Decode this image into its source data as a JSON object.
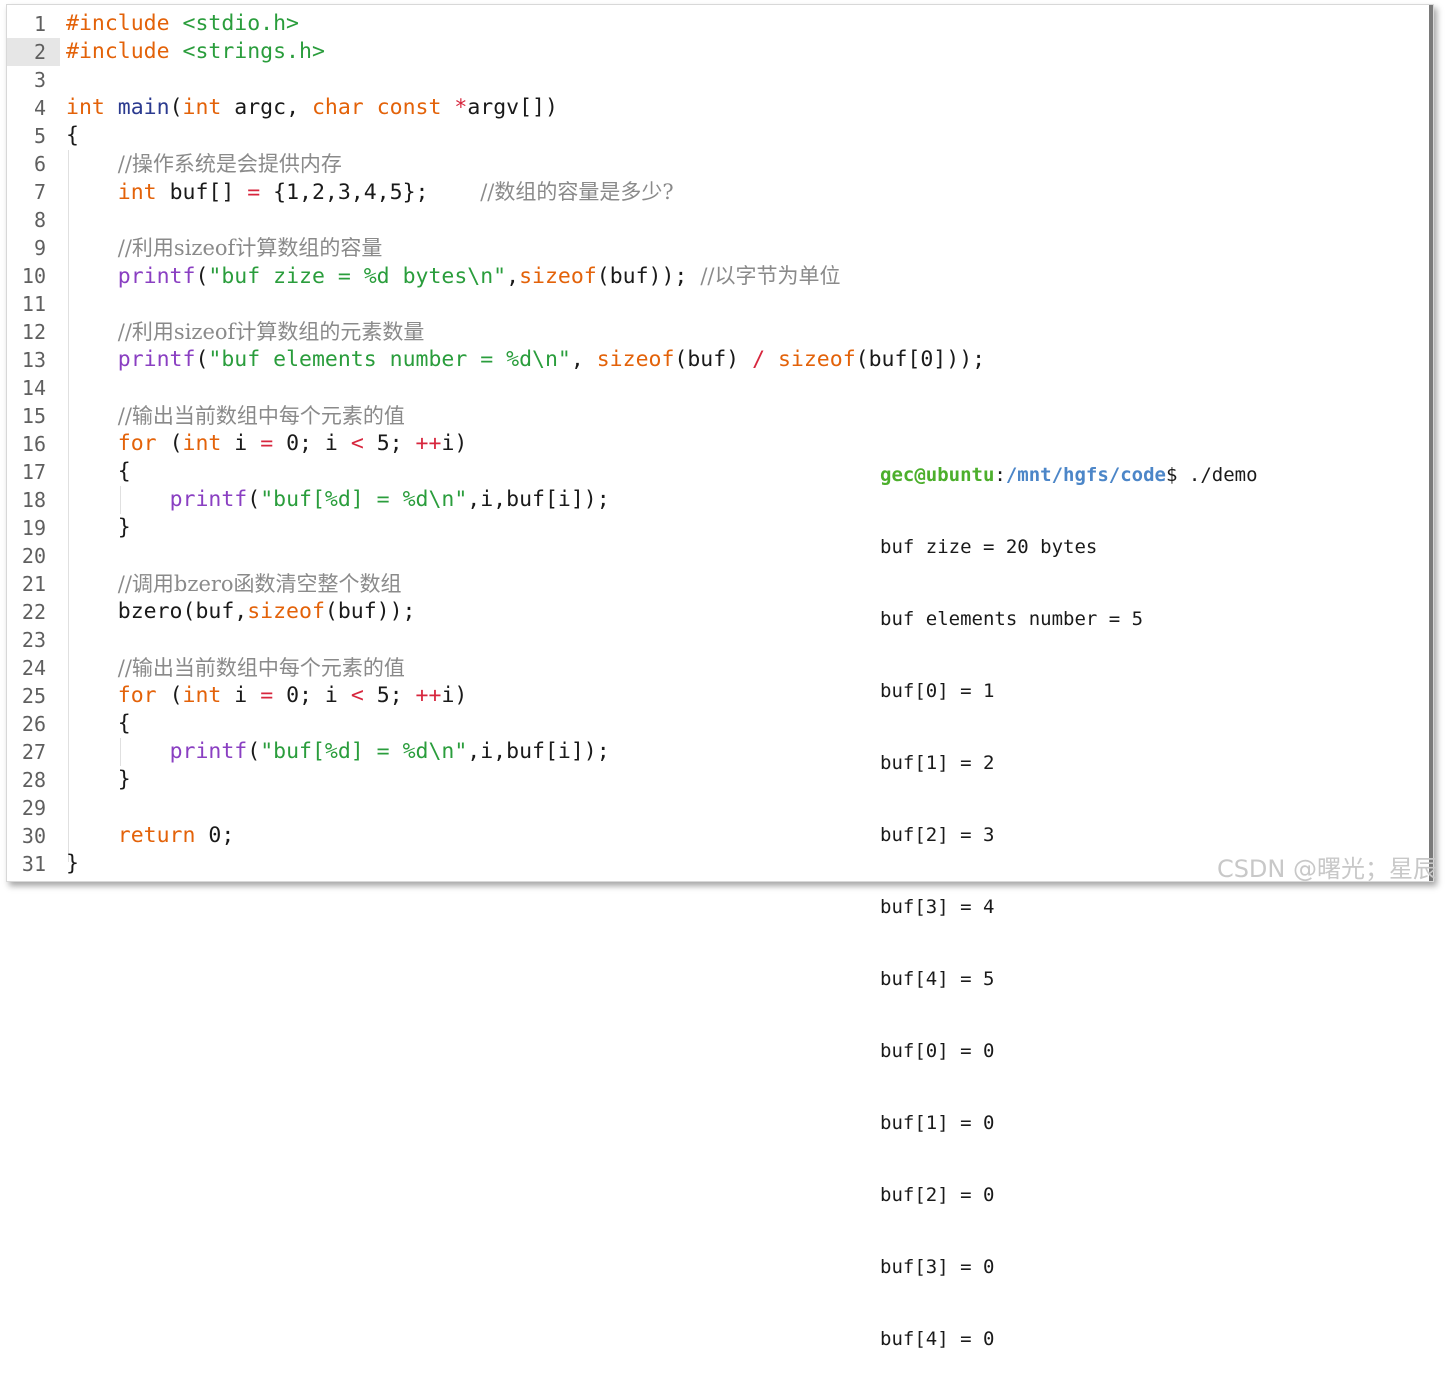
{
  "editor": {
    "highlighted_line": 2,
    "lines": [
      {
        "n": "1",
        "tokens": [
          [
            "kw",
            "#include "
          ],
          [
            "str",
            "<stdio.h>"
          ]
        ]
      },
      {
        "n": "2",
        "tokens": [
          [
            "kw",
            "#include "
          ],
          [
            "str",
            "<strings.h>"
          ]
        ]
      },
      {
        "n": "3",
        "tokens": []
      },
      {
        "n": "4",
        "tokens": [
          [
            "kw",
            "int "
          ],
          [
            "mainfn",
            "main"
          ],
          [
            "id",
            "("
          ],
          [
            "kw",
            "int "
          ],
          [
            "id",
            "argc, "
          ],
          [
            "kw",
            "char const "
          ],
          [
            "op",
            "*"
          ],
          [
            "id",
            "argv[])"
          ]
        ]
      },
      {
        "n": "5",
        "tokens": [
          [
            "id",
            "{"
          ]
        ]
      },
      {
        "n": "6",
        "tokens": [
          [
            "id",
            "    "
          ],
          [
            "com",
            "//操作系统是会提供内存"
          ]
        ]
      },
      {
        "n": "7",
        "tokens": [
          [
            "id",
            "    "
          ],
          [
            "kw",
            "int "
          ],
          [
            "id",
            "buf[] "
          ],
          [
            "op",
            "= "
          ],
          [
            "id",
            "{1,2,3,4,5};    "
          ],
          [
            "com",
            "//数组的容量是多少?"
          ]
        ]
      },
      {
        "n": "8",
        "tokens": []
      },
      {
        "n": "9",
        "tokens": [
          [
            "id",
            "    "
          ],
          [
            "com",
            "//利用sizeof计算数组的容量"
          ]
        ]
      },
      {
        "n": "10",
        "tokens": [
          [
            "id",
            "    "
          ],
          [
            "fn",
            "printf"
          ],
          [
            "id",
            "("
          ],
          [
            "str",
            "\"buf zize = %d bytes\\n\""
          ],
          [
            "id",
            ","
          ],
          [
            "kw",
            "sizeof"
          ],
          [
            "id",
            "(buf)); "
          ],
          [
            "com",
            "//以字节为单位"
          ]
        ]
      },
      {
        "n": "11",
        "tokens": []
      },
      {
        "n": "12",
        "tokens": [
          [
            "id",
            "    "
          ],
          [
            "com",
            "//利用sizeof计算数组的元素数量"
          ]
        ]
      },
      {
        "n": "13",
        "tokens": [
          [
            "id",
            "    "
          ],
          [
            "fn",
            "printf"
          ],
          [
            "id",
            "("
          ],
          [
            "str",
            "\"buf elements number = %d\\n\""
          ],
          [
            "id",
            ", "
          ],
          [
            "kw",
            "sizeof"
          ],
          [
            "id",
            "(buf) "
          ],
          [
            "op",
            "/ "
          ],
          [
            "kw",
            "sizeof"
          ],
          [
            "id",
            "(buf[0]));"
          ]
        ]
      },
      {
        "n": "14",
        "tokens": []
      },
      {
        "n": "15",
        "tokens": [
          [
            "id",
            "    "
          ],
          [
            "com",
            "//输出当前数组中每个元素的值"
          ]
        ]
      },
      {
        "n": "16",
        "tokens": [
          [
            "id",
            "    "
          ],
          [
            "kw",
            "for "
          ],
          [
            "id",
            "("
          ],
          [
            "kw",
            "int "
          ],
          [
            "id",
            "i "
          ],
          [
            "op",
            "= "
          ],
          [
            "id",
            "0; i "
          ],
          [
            "op",
            "< "
          ],
          [
            "id",
            "5; "
          ],
          [
            "op",
            "++"
          ],
          [
            "id",
            "i)"
          ]
        ]
      },
      {
        "n": "17",
        "tokens": [
          [
            "id",
            "    {"
          ]
        ]
      },
      {
        "n": "18",
        "tokens": [
          [
            "id",
            "        "
          ],
          [
            "fn",
            "printf"
          ],
          [
            "id",
            "("
          ],
          [
            "str",
            "\"buf[%d] = %d\\n\""
          ],
          [
            "id",
            ",i,buf[i]);"
          ]
        ]
      },
      {
        "n": "19",
        "tokens": [
          [
            "id",
            "    }"
          ]
        ]
      },
      {
        "n": "20",
        "tokens": []
      },
      {
        "n": "21",
        "tokens": [
          [
            "id",
            "    "
          ],
          [
            "com",
            "//调用bzero函数清空整个数组"
          ]
        ]
      },
      {
        "n": "22",
        "tokens": [
          [
            "id",
            "    bzero(buf,"
          ],
          [
            "kw",
            "sizeof"
          ],
          [
            "id",
            "(buf));"
          ]
        ]
      },
      {
        "n": "23",
        "tokens": []
      },
      {
        "n": "24",
        "tokens": [
          [
            "id",
            "    "
          ],
          [
            "com",
            "//输出当前数组中每个元素的值"
          ]
        ]
      },
      {
        "n": "25",
        "tokens": [
          [
            "id",
            "    "
          ],
          [
            "kw",
            "for "
          ],
          [
            "id",
            "("
          ],
          [
            "kw",
            "int "
          ],
          [
            "id",
            "i "
          ],
          [
            "op",
            "= "
          ],
          [
            "id",
            "0; i "
          ],
          [
            "op",
            "< "
          ],
          [
            "id",
            "5; "
          ],
          [
            "op",
            "++"
          ],
          [
            "id",
            "i)"
          ]
        ]
      },
      {
        "n": "26",
        "tokens": [
          [
            "id",
            "    {"
          ]
        ]
      },
      {
        "n": "27",
        "tokens": [
          [
            "id",
            "        "
          ],
          [
            "fn",
            "printf"
          ],
          [
            "id",
            "("
          ],
          [
            "str",
            "\"buf[%d] = %d\\n\""
          ],
          [
            "id",
            ",i,buf[i]);"
          ]
        ]
      },
      {
        "n": "28",
        "tokens": [
          [
            "id",
            "    }"
          ]
        ]
      },
      {
        "n": "29",
        "tokens": []
      },
      {
        "n": "30",
        "tokens": [
          [
            "id",
            "    "
          ],
          [
            "kw",
            "return "
          ],
          [
            "id",
            "0;"
          ]
        ]
      },
      {
        "n": "31",
        "tokens": [
          [
            "id",
            "}"
          ]
        ]
      }
    ]
  },
  "terminal": {
    "prompt_user": "gec@ubuntu",
    "prompt_sep": ":",
    "prompt_path": "/mnt/hgfs/code",
    "prompt_command": "$ ./demo",
    "output": [
      "buf zize = 20 bytes",
      "buf elements number = 5",
      "buf[0] = 1",
      "buf[1] = 2",
      "buf[2] = 3",
      "buf[3] = 4",
      "buf[4] = 5",
      "buf[0] = 0",
      "buf[1] = 0",
      "buf[2] = 0",
      "buf[3] = 0",
      "buf[4] = 0"
    ]
  },
  "watermark": "CSDN @曙光；星辰"
}
